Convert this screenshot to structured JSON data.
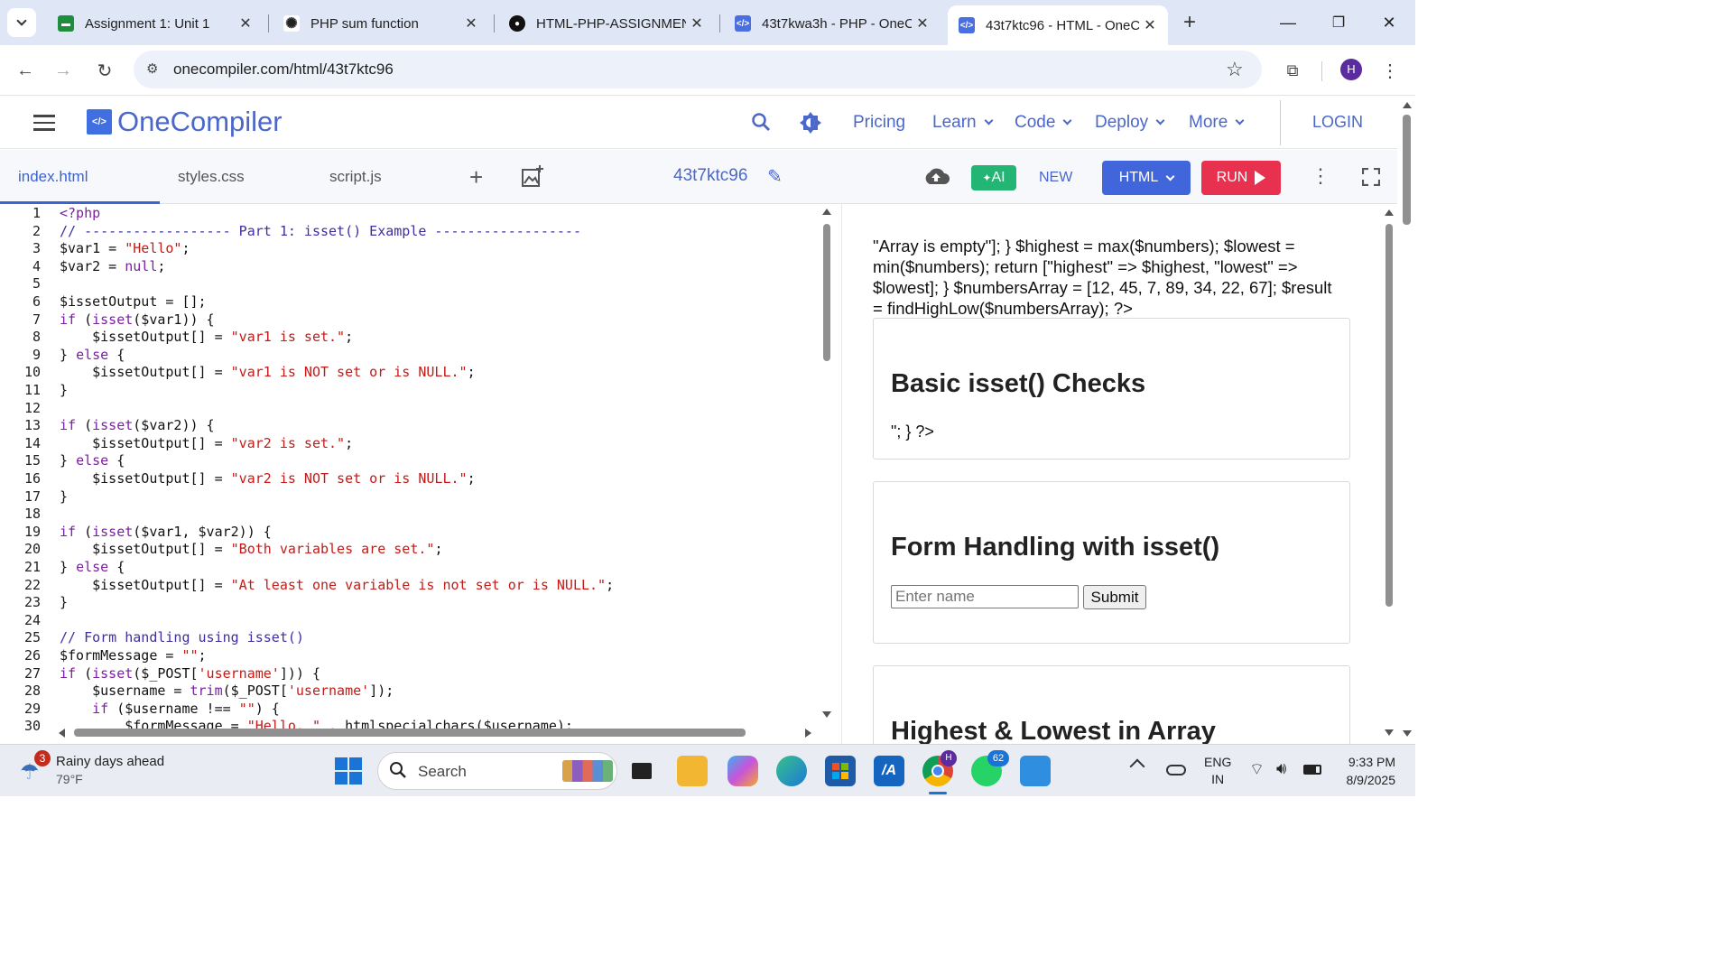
{
  "browser": {
    "tabs": [
      {
        "title": "Assignment 1: Unit 1",
        "icon": "classroom-icon",
        "color": "#1e8e3e"
      },
      {
        "title": "PHP sum function",
        "icon": "chatgpt-icon",
        "color": "#222222"
      },
      {
        "title": "HTML-PHP-ASSIGNMEN",
        "icon": "github-icon",
        "color": "#111111"
      },
      {
        "title": "43t7kwa3h - PHP - OneC",
        "icon": "onecompiler-icon",
        "color": "#4a6fe0"
      },
      {
        "title": "43t7ktc96 - HTML - OneC",
        "icon": "onecompiler-icon",
        "color": "#4a6fe0"
      }
    ],
    "url": "onecompiler.com/html/43t7ktc96",
    "profile_initial": "H"
  },
  "app": {
    "logo_text": "OneCompiler",
    "logo_mark": "</>",
    "menu": {
      "pricing": "Pricing",
      "learn": "Learn",
      "code": "Code",
      "deploy": "Deploy",
      "more": "More",
      "login": "LOGIN"
    }
  },
  "editor": {
    "files": [
      "index.html",
      "styles.css",
      "script.js"
    ],
    "project_name": "43t7ktc96",
    "ai_label": "AI",
    "new_label": "NEW",
    "language": "HTML",
    "run_label": "RUN",
    "lines": [
      "<?php",
      "// ------------------ Part 1: isset() Example ------------------",
      "$var1 = \"Hello\";",
      "$var2 = null;",
      "",
      "$issetOutput = [];",
      "if (isset($var1)) {",
      "    $issetOutput[] = \"var1 is set.\";",
      "} else {",
      "    $issetOutput[] = \"var1 is NOT set or is NULL.\";",
      "}",
      "",
      "if (isset($var2)) {",
      "    $issetOutput[] = \"var2 is set.\";",
      "} else {",
      "    $issetOutput[] = \"var2 is NOT set or is NULL.\";",
      "}",
      "",
      "if (isset($var1, $var2)) {",
      "    $issetOutput[] = \"Both variables are set.\";",
      "} else {",
      "    $issetOutput[] = \"At least one variable is not set or is NULL.\";",
      "}",
      "",
      "// Form handling using isset()",
      "$formMessage = \"\";",
      "if (isset($_POST['username'])) {",
      "    $username = trim($_POST['username']);",
      "    if ($username !== \"\") {",
      "        $formMessage = \"Hello, \" . htmlspecialchars($username);"
    ]
  },
  "output": {
    "raw_text": "\"Array is empty\"]; } $highest = max($numbers); $lowest = min($numbers); return [\"highest\" => $highest, \"lowest\" => $lowest]; } $numbersArray = [12, 45, 7, 89, 34, 22, 67]; $result = findHighLow($numbersArray); ?>",
    "card1": {
      "title": "Basic isset() Checks",
      "text": "\"; } ?>"
    },
    "card2": {
      "title": "Form Handling with isset()",
      "placeholder": "Enter name",
      "button": "Submit"
    },
    "card3": {
      "title": "Highest & Lowest in Array"
    }
  },
  "taskbar": {
    "weather_badge": "3",
    "weather_title": "Rainy days ahead",
    "weather_temp": "79°F",
    "search_label": "Search",
    "whatsapp_badge": "62",
    "lang_top": "ENG",
    "lang_bottom": "IN",
    "time": "9:33 PM",
    "date": "8/9/2025"
  }
}
